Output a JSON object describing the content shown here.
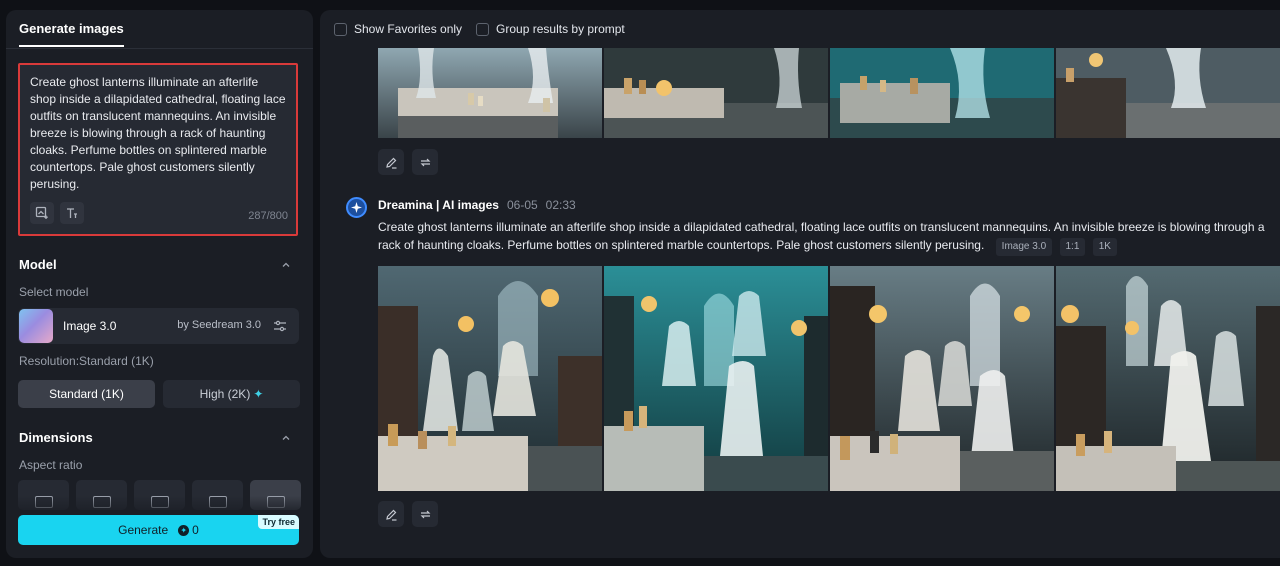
{
  "left_panel": {
    "tab": "Generate images",
    "prompt": "Create ghost lanterns illuminate an afterlife shop inside a dilapidated cathedral, floating lace outfits on translucent mannequins. An invisible breeze is blowing through a rack of haunting cloaks. Perfume bottles on splintered marble countertops. Pale ghost customers silently perusing.",
    "char_count": "287/800",
    "model_section": "Model",
    "select_model_label": "Select model",
    "model_name": "Image 3.0",
    "model_by": "by Seedream 3.0",
    "resolution_label": "Resolution:Standard (1K)",
    "res_standard": "Standard (1K)",
    "res_high": "High (2K)",
    "dimensions_section": "Dimensions",
    "aspect_label": "Aspect ratio",
    "generate_label": "Generate",
    "generate_credits": "0",
    "try_free": "Try free"
  },
  "main": {
    "show_favorites": "Show Favorites only",
    "group_by_prompt": "Group results by prompt",
    "message": {
      "author": "Dreamina | AI images",
      "date": "06-05",
      "time": "02:33",
      "prompt": "Create ghost lanterns illuminate an afterlife shop inside a dilapidated cathedral, floating lace outfits on translucent mannequins. An invisible breeze is blowing through a rack of haunting cloaks. Perfume bottles on splintered marble countertops. Pale ghost customers silently perusing.",
      "tag_model": "Image 3.0",
      "tag_ratio": "1:1",
      "tag_res": "1K"
    }
  },
  "colors": {
    "accent": "#19d4f0",
    "panel": "#1b1e25",
    "highlight_border": "#d93a3a"
  }
}
